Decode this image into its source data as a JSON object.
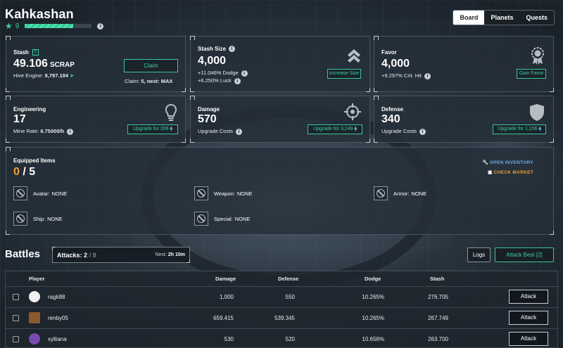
{
  "header": {
    "title": "Kahkashan",
    "level": "9",
    "xp_fraction": 0.72
  },
  "tabs": [
    {
      "label": "Board"
    },
    {
      "label": "Planets"
    },
    {
      "label": "Quests"
    }
  ],
  "stash": {
    "label": "Stash",
    "value": "49.106",
    "unit": "SCRAP",
    "hive_label": "Hive Engine:",
    "hive_value": "8,797.194",
    "claim_btn": "Claim",
    "claim_info_label": "Claim:",
    "claim_info": "5, next: MAX"
  },
  "stash_size": {
    "label": "Stash Size",
    "value": "4,000",
    "dodge": "+11.046%",
    "dodge_label": "Dodge",
    "luck": "+6.250%",
    "luck_label": "Luck",
    "btn": "Increase Size"
  },
  "favor": {
    "label": "Favor",
    "value": "4,000",
    "crit": "+9.297%",
    "crit_label": "Crit. Hit",
    "btn": "Gain Favor"
  },
  "engineering": {
    "label": "Engineering",
    "value": "17",
    "rate_label": "Mine Rate:",
    "rate": "6.75000/h",
    "btn": "Upgrade for 289"
  },
  "damage": {
    "label": "Damage",
    "value": "570",
    "sub": "Upgrade Costs",
    "btn": "Upgrade for 3,249"
  },
  "defense": {
    "label": "Defense",
    "value": "340",
    "sub": "Upgrade Costs",
    "btn": "Upgrade for 1,156"
  },
  "equipped": {
    "label": "Equipped Items",
    "count": "0",
    "sep": "/",
    "max": "5",
    "open_inventory": "OPEN INVENTORY",
    "check_market": "CHECK MARKET",
    "slots": [
      {
        "label": "Avatar:",
        "value": "NONE"
      },
      {
        "label": "Weapon:",
        "value": "NONE"
      },
      {
        "label": "Armor:",
        "value": "NONE"
      },
      {
        "label": "Ship:",
        "value": "NONE"
      },
      {
        "label": "Special:",
        "value": "NONE"
      }
    ]
  },
  "battles": {
    "title": "Battles",
    "attacks_label": "Attacks:",
    "attacks": "2",
    "attacks_max": "/ 8",
    "next_label": "Next:",
    "next": "2h 10m",
    "logs": "Logs",
    "attack_best": "Attack Best [2]"
  },
  "table": {
    "headers": {
      "player": "Player",
      "damage": "Damage",
      "defense": "Defense",
      "dodge": "Dodge",
      "stash": "Stash"
    },
    "rows": [
      {
        "player": "ragk88",
        "damage": "1,000",
        "defense": "550",
        "dodge": "10.265%",
        "stash": "276.705",
        "action": "Attack",
        "avatar_color": "#f0f0f0"
      },
      {
        "player": "renby05",
        "damage": "659.415",
        "defense": "539.345",
        "dodge": "10.265%",
        "stash": "267.749",
        "action": "Attack",
        "avatar_color": "#8a5a30"
      },
      {
        "player": "xylliana",
        "damage": "530",
        "defense": "520",
        "dodge": "10.656%",
        "stash": "263.700",
        "action": "Attack",
        "avatar_color": "#7a4ab0"
      }
    ]
  },
  "colors": {
    "accent": "#3ad0a0",
    "orange": "#f0a030",
    "link_blue": "#6fa8e0"
  }
}
